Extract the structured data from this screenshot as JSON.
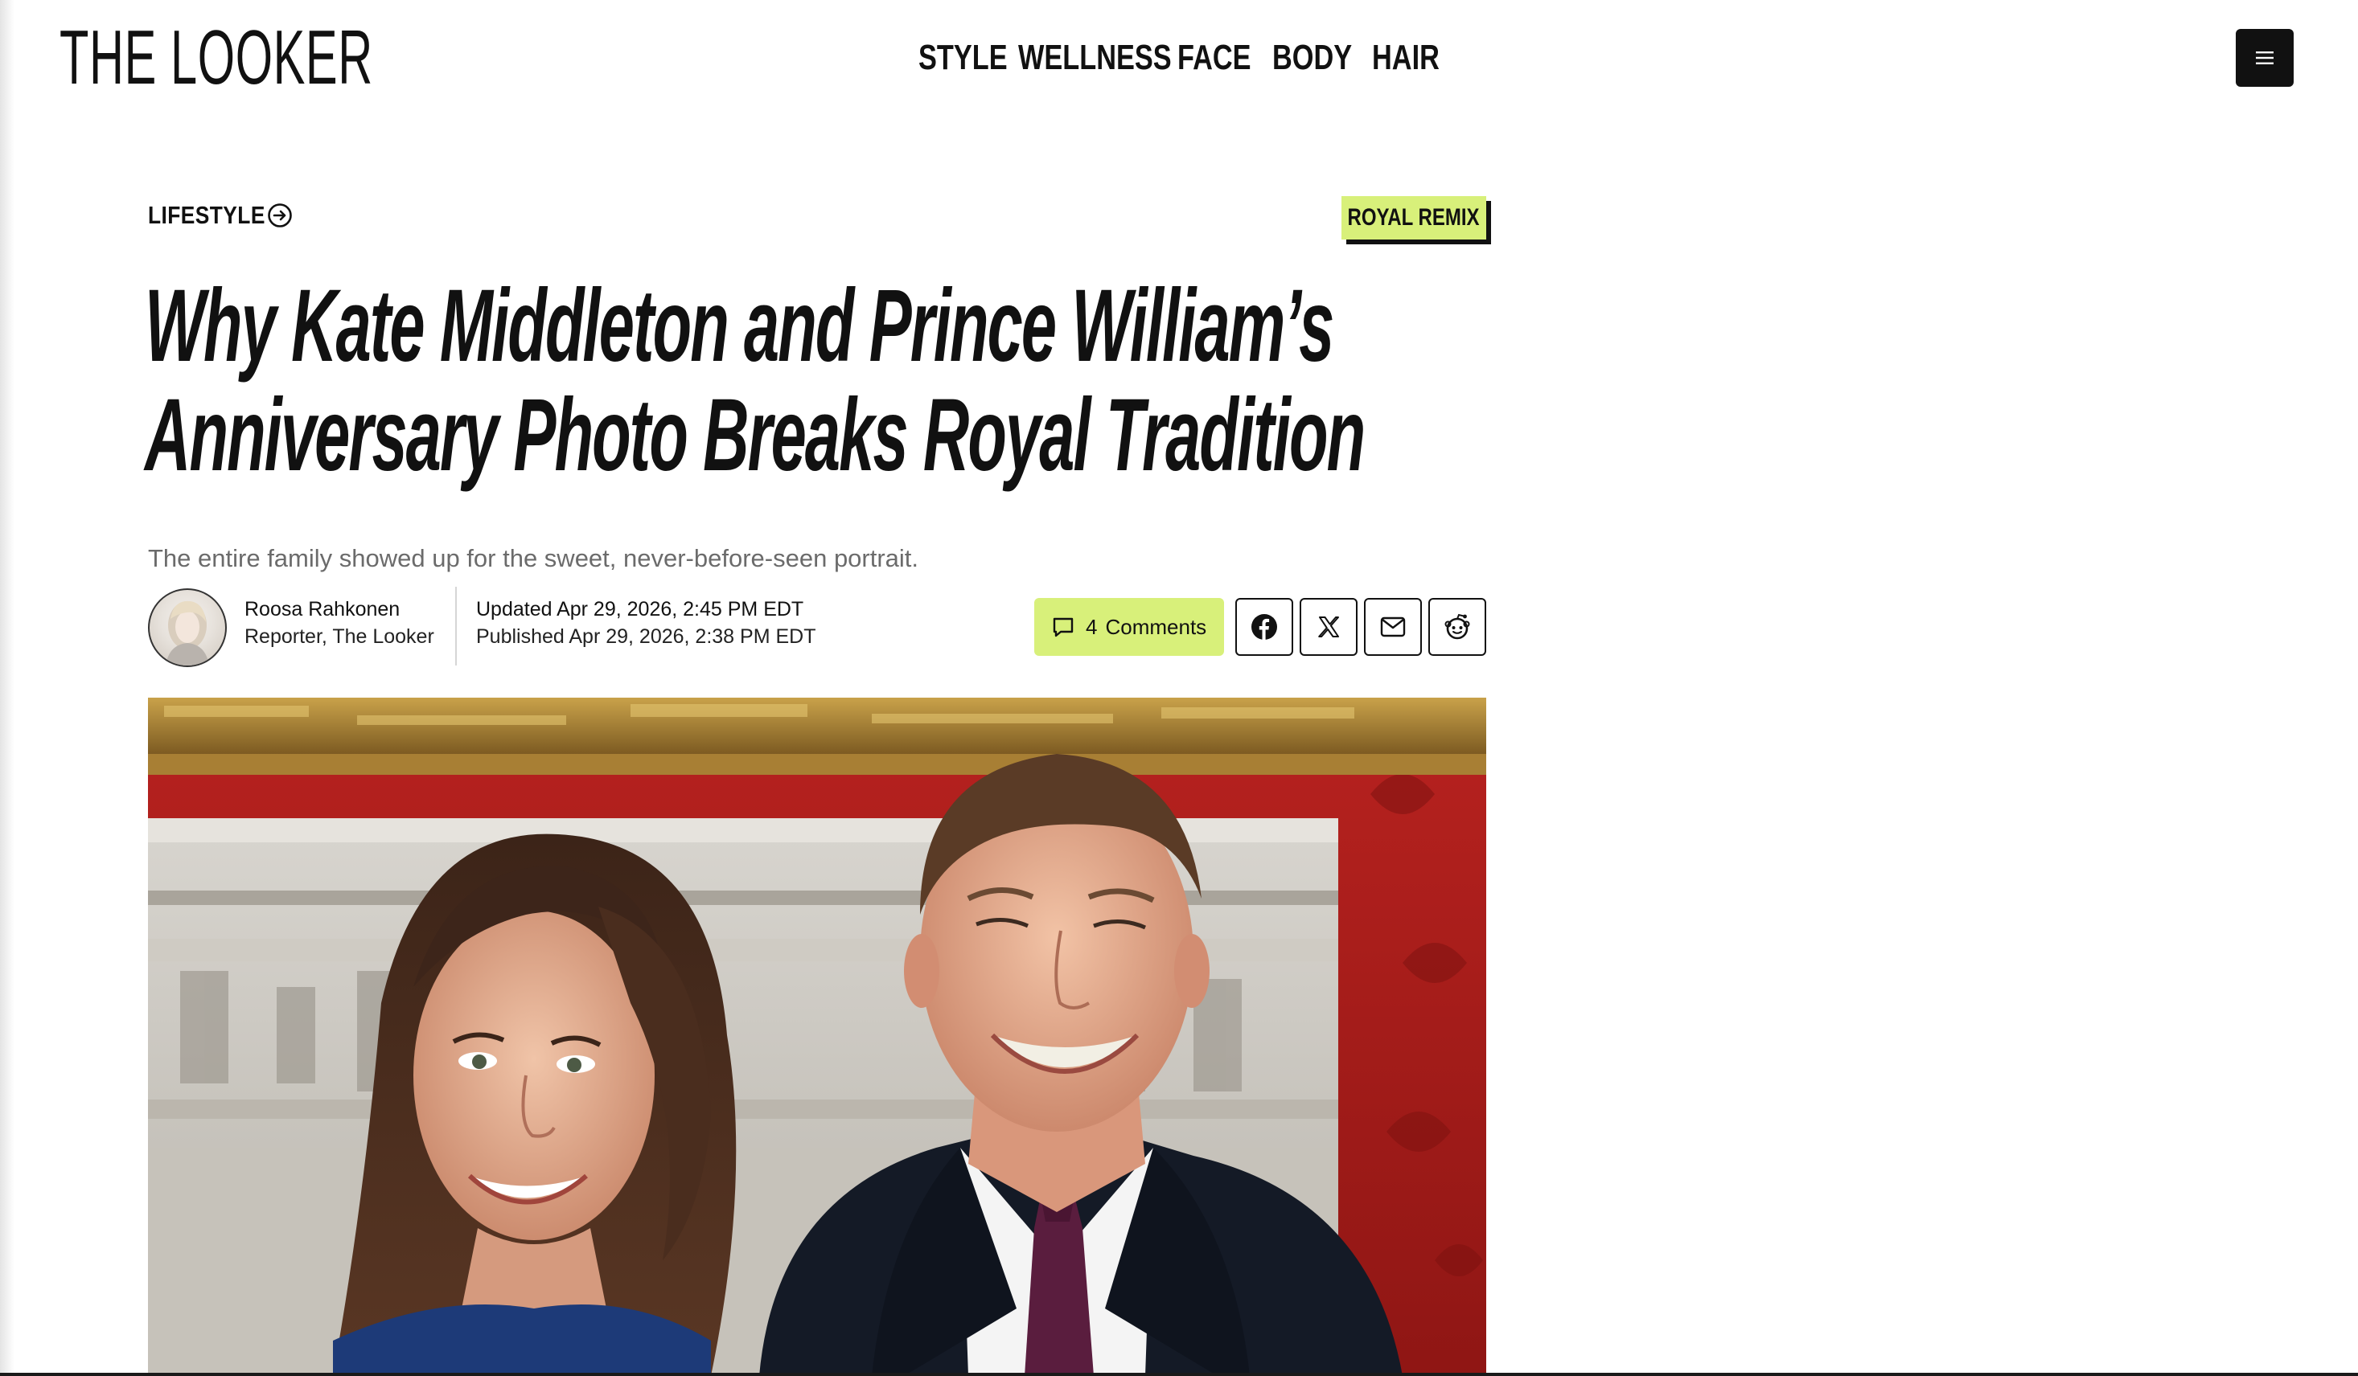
{
  "brand": {
    "logo": "THE LOOKER"
  },
  "nav": {
    "items": [
      {
        "label": "STYLE"
      },
      {
        "label": "WELLNESS"
      },
      {
        "label": "FACE"
      },
      {
        "label": "BODY"
      },
      {
        "label": "HAIR"
      }
    ],
    "menu_icon": "hamburger-menu-icon"
  },
  "article": {
    "category": "LIFESTYLE",
    "category_icon": "arrow-right-circle-icon",
    "badge": "ROYAL REMIX",
    "headline_line1": "Why Kate Middleton and Prince William’s",
    "headline_line2": "Anniversary Photo Breaks Royal Tradition",
    "dek": "The entire family showed up for the sweet, never-before-seen portrait."
  },
  "byline": {
    "author_name": "Roosa Rahkonen",
    "author_role": "Reporter, The Looker",
    "updated": "Updated Apr 29, 2026, 2:45 PM EDT",
    "published": "Published Apr 29, 2026, 2:38 PM EDT"
  },
  "actions": {
    "comments_count": "4",
    "comments_label": "Comments",
    "comment_icon": "speech-bubble-icon",
    "share_icons": [
      "facebook-icon",
      "x-icon",
      "email-icon",
      "reddit-icon"
    ]
  },
  "colors": {
    "accent": "#d8f07a",
    "text": "#111111",
    "muted": "#6b6b6b"
  }
}
